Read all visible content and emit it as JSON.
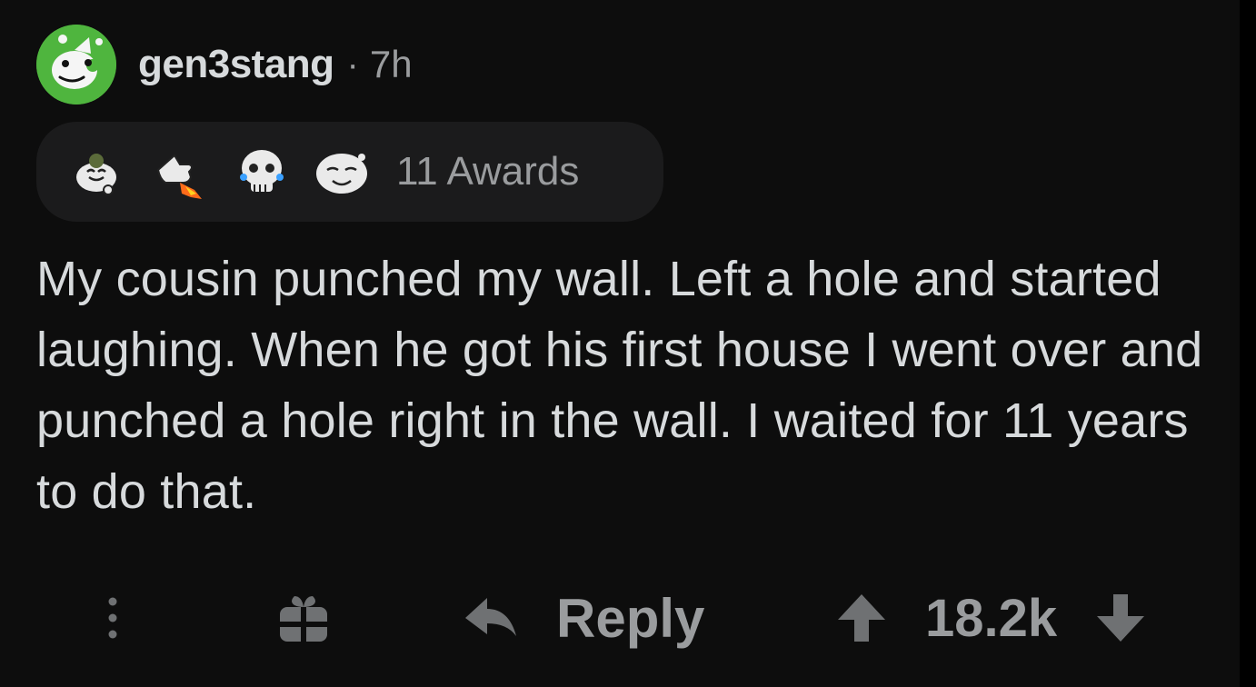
{
  "comment": {
    "author": "gen3stang",
    "separator": "·",
    "age": "7h",
    "awards": {
      "count_label": "11 Awards",
      "icons": [
        "wholesome-award-icon",
        "rocket-like-award-icon",
        "skull-laughing-award-icon",
        "snoo-smile-award-icon"
      ]
    },
    "body": "My cousin punched my wall. Left a hole and started laughing. When he got his first house I went over and punched a hole right in the wall. I waited for 11 years to do that.",
    "actions": {
      "more_icon": "more-options-icon",
      "gift_icon": "gift-icon",
      "reply_label": "Reply",
      "score": "18.2k"
    },
    "colors": {
      "background": "#0d0d0d",
      "text": "#d7dadc",
      "muted": "#9a9c9e",
      "avatar": "#4fb53e",
      "awards_bg": "#1b1b1c"
    }
  }
}
